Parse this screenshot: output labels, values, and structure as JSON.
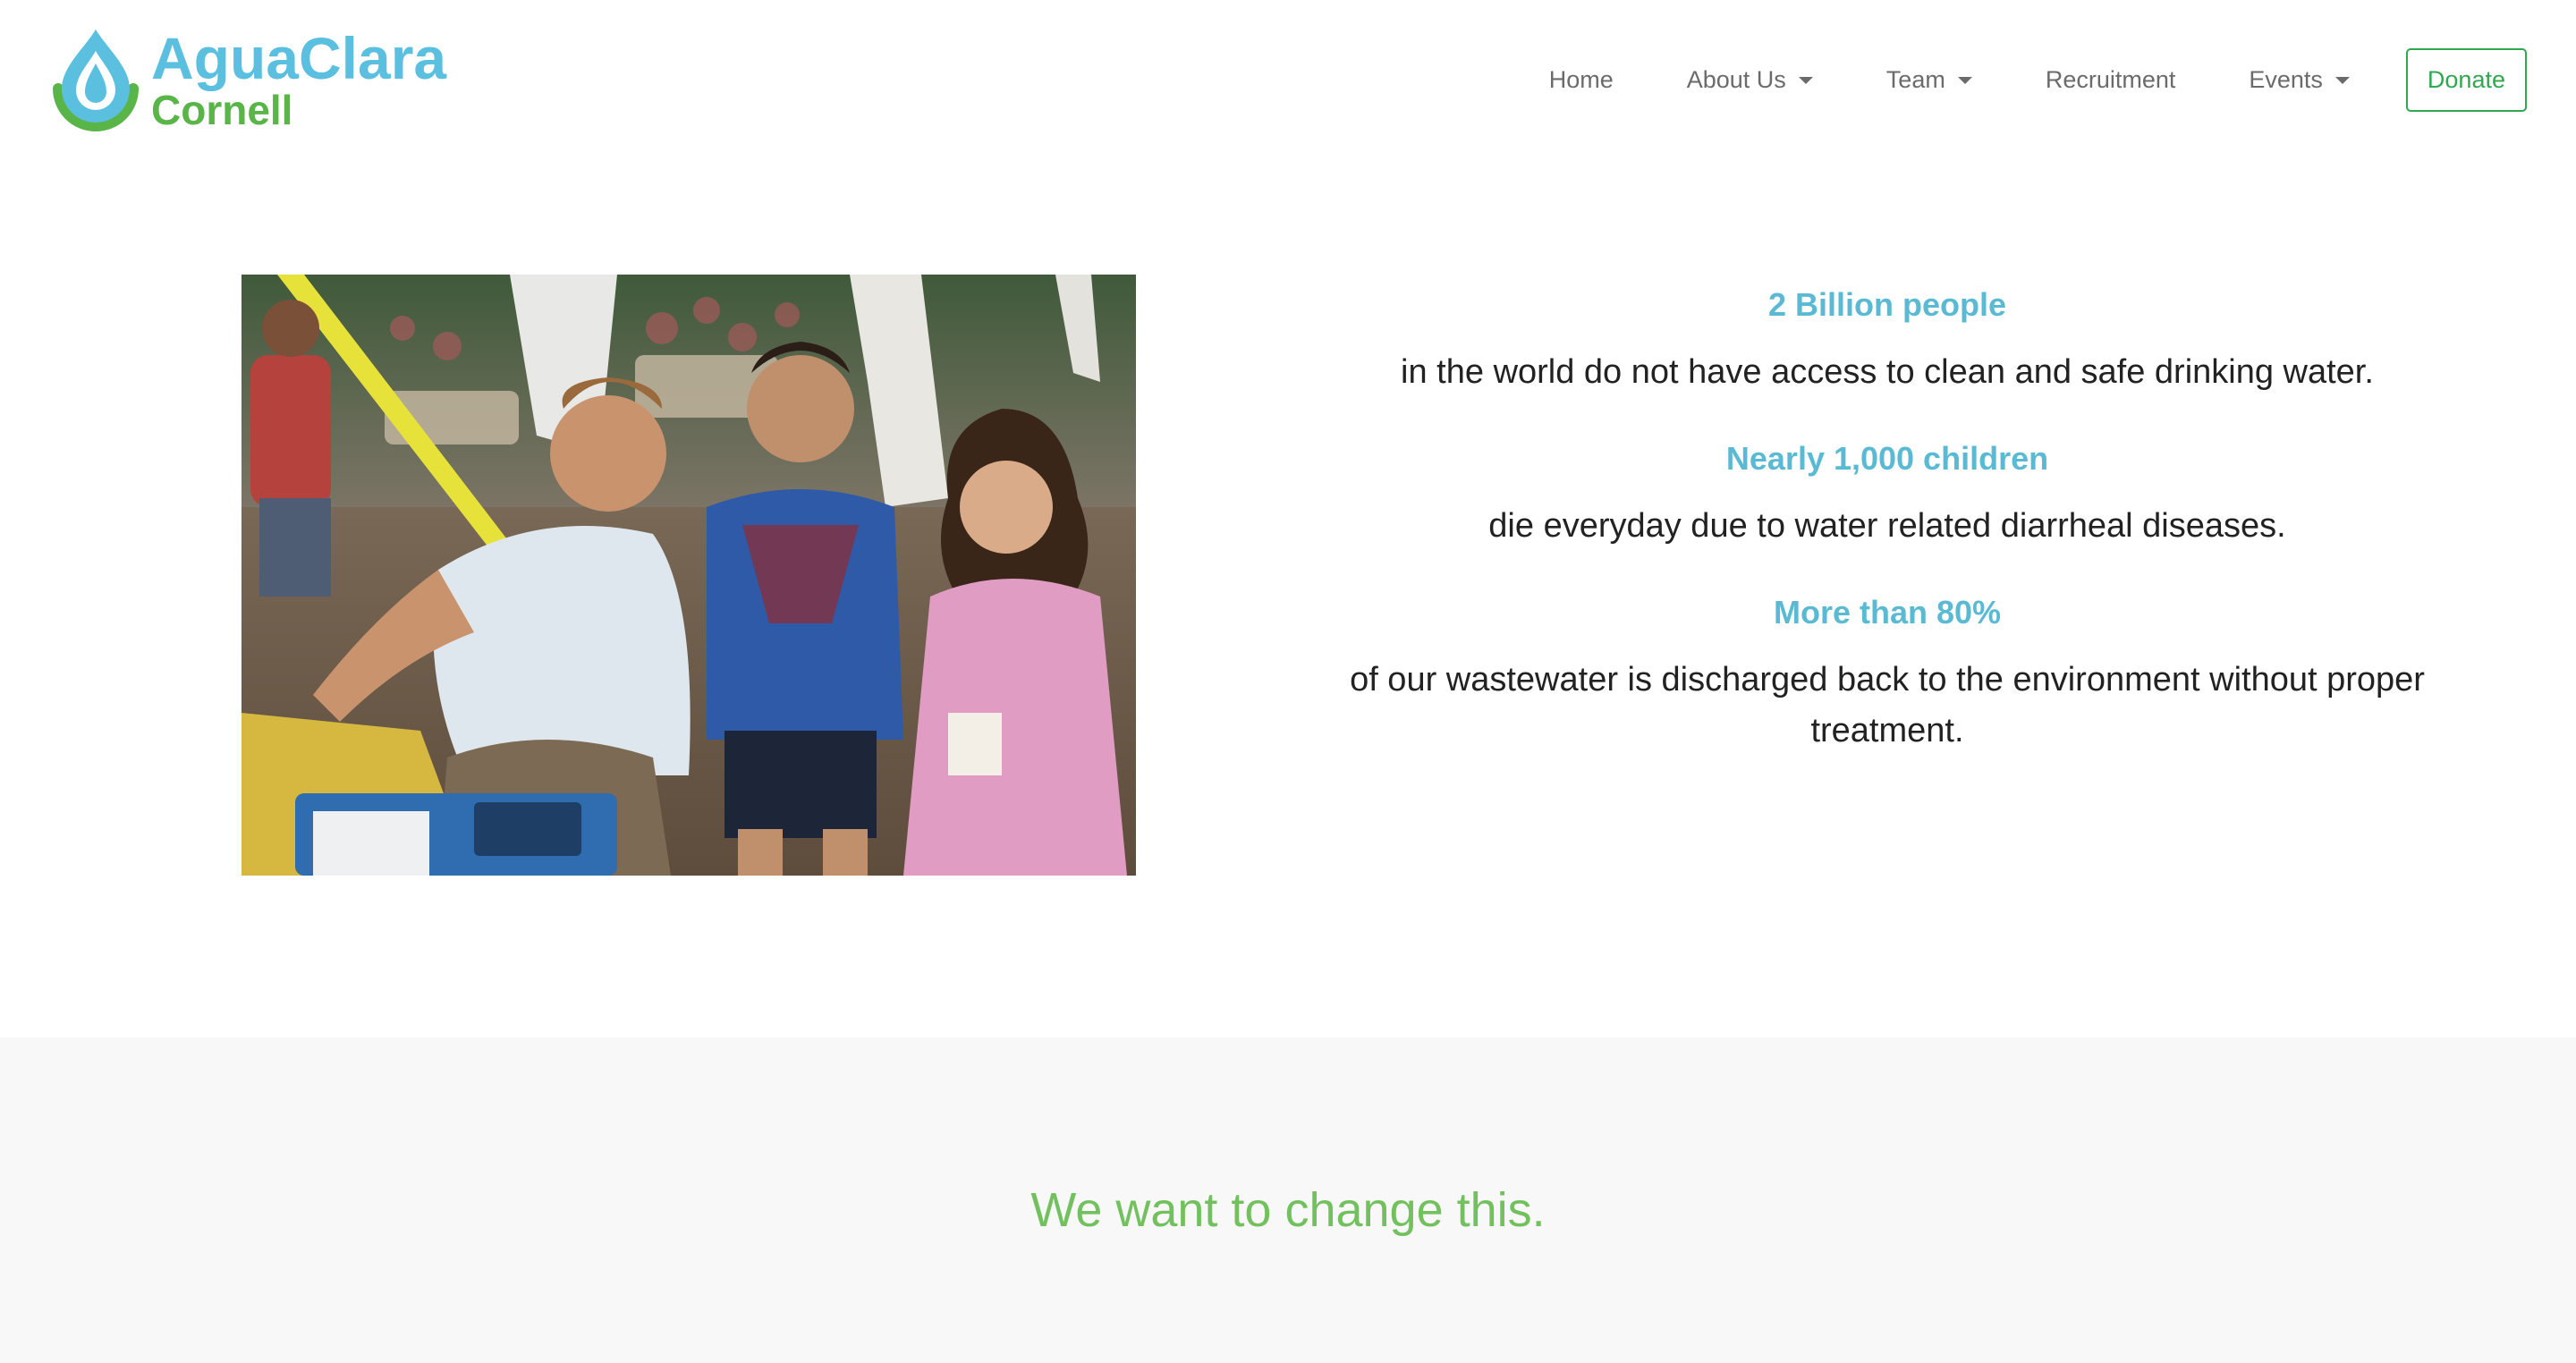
{
  "brand": {
    "name_line1": "AguaClara",
    "name_line2": "Cornell",
    "logo_icon": "water-drop-icon",
    "colors": {
      "blue": "#5bbfe0",
      "green": "#59b548"
    }
  },
  "nav": {
    "items": [
      {
        "label": "Home",
        "dropdown": false
      },
      {
        "label": "About Us",
        "dropdown": true
      },
      {
        "label": "Team",
        "dropdown": true
      },
      {
        "label": "Recruitment",
        "dropdown": false
      },
      {
        "label": "Events",
        "dropdown": true
      }
    ],
    "donate_label": "Donate",
    "donate_color": "#2fa84f"
  },
  "hero": {
    "photo_icon": "photo-image"
  },
  "stats": [
    {
      "headline": "2 Billion people",
      "body": "in the world do not have access to clean and safe drinking water."
    },
    {
      "headline": "Nearly 1,000 children",
      "body": "die everyday due to water related diarrheal diseases."
    },
    {
      "headline": "More than 80%",
      "body": "of our wastewater is discharged back to the environment without proper treatment."
    }
  ],
  "callout": {
    "title": "We want to change this.",
    "color": "#72c15e"
  }
}
